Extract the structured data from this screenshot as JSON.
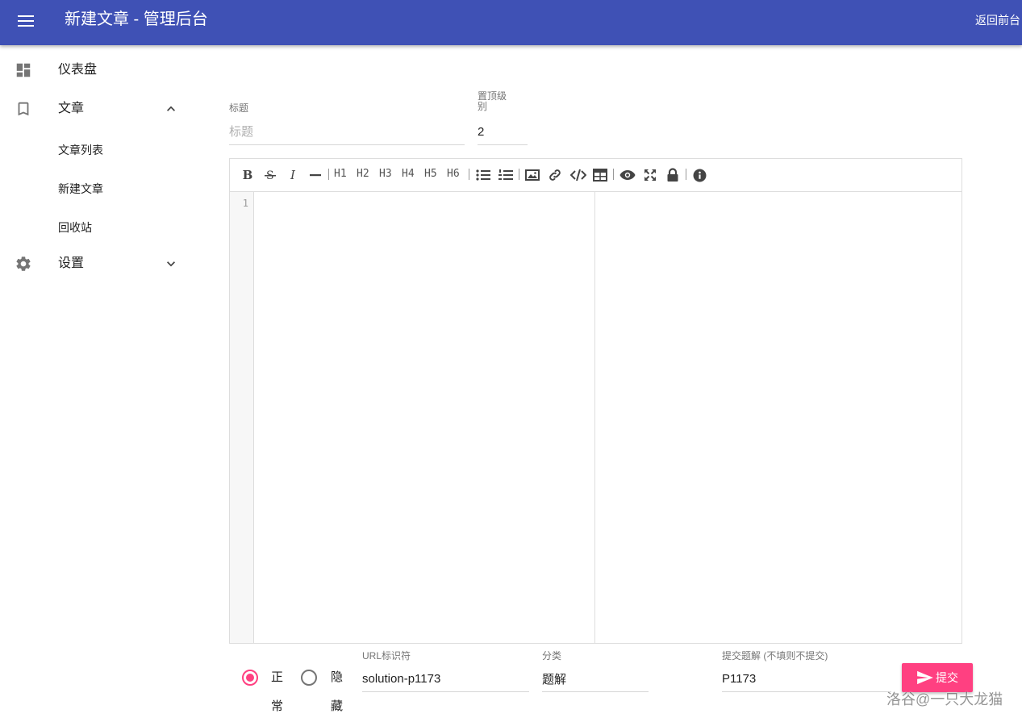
{
  "header": {
    "title": "新建文章 - 管理后台",
    "back_link": "返回前台"
  },
  "sidebar": {
    "dashboard": "仪表盘",
    "articles": "文章",
    "article_list": "文章列表",
    "new_article": "新建文章",
    "recycle_bin": "回收站",
    "settings": "设置"
  },
  "form": {
    "title_label": "标题",
    "title_placeholder": "标题",
    "title_value": "",
    "pin_label": "置顶级别",
    "pin_value": "2",
    "line_number": "1",
    "status_normal": "正常",
    "status_hidden": "隐藏",
    "status_selected": "正常",
    "url_label": "URL标识符",
    "url_value": "solution-p1173",
    "category_label": "分类",
    "category_value": "题解",
    "solution_label": "提交题解 (不填则不提交)",
    "solution_value": "P1173",
    "submit_label": "提交"
  },
  "toolbar": {
    "headings": [
      "H1",
      "H2",
      "H3",
      "H4",
      "H5",
      "H6"
    ],
    "bold": "B",
    "italic": "I"
  },
  "watermark": "洛谷@一只大龙猫",
  "colors": {
    "primary": "#3f51b5",
    "accent": "#ff4081"
  },
  "icons": [
    "menu-icon",
    "dashboard-icon",
    "bookmark-icon",
    "gear-icon",
    "chevron-up-icon",
    "chevron-down-icon",
    "send-icon"
  ]
}
